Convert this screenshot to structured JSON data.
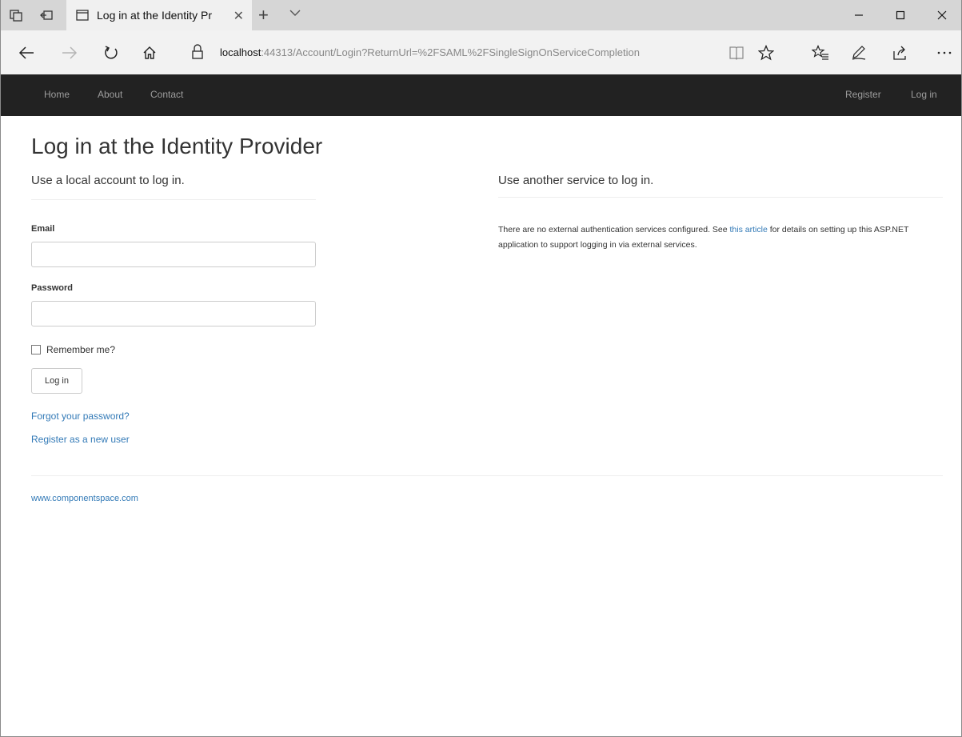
{
  "browser": {
    "tab_title": "Log in at the Identity Pr",
    "url_host": "localhost",
    "url_rest": ":44313/Account/Login?ReturnUrl=%2FSAML%2FSingleSignOnServiceCompletion"
  },
  "navbar": {
    "home": "Home",
    "about": "About",
    "contact": "Contact",
    "register": "Register",
    "login": "Log in"
  },
  "page": {
    "title": "Log in at the Identity Provider",
    "local_heading": "Use a local account to log in.",
    "external_heading": "Use another service to log in.",
    "email_label": "Email",
    "email_value": "",
    "password_label": "Password",
    "password_value": "",
    "remember_label": "Remember me?",
    "remember_checked": false,
    "login_button": "Log in",
    "forgot_link": "Forgot your password?",
    "register_link": "Register as a new user",
    "external_text_1": "There are no external authentication services configured. See ",
    "external_link": "this article",
    "external_text_2": " for details on setting up this ASP.NET application to support logging in via external services.",
    "footer_link": "www.componentspace.com"
  },
  "colors": {
    "navbar_bg": "#222222",
    "navbar_text": "#9d9d9d",
    "link": "#337ab7"
  }
}
